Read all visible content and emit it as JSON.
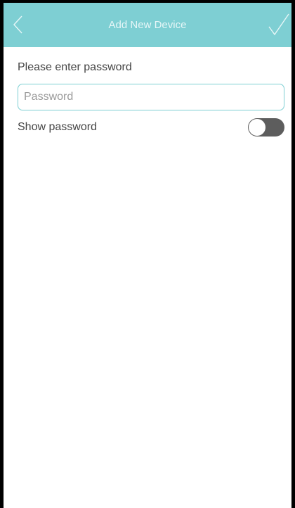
{
  "app_bar": {
    "title": "Add New Device",
    "back_icon": "chevron-left-icon",
    "confirm_icon": "check-icon",
    "color": "#7ecfd3"
  },
  "form": {
    "prompt": "Please enter password",
    "password": {
      "value": "",
      "placeholder": "Password"
    },
    "show_password": {
      "label": "Show password",
      "on": false,
      "toggle_color": "#5d5d5d"
    }
  }
}
